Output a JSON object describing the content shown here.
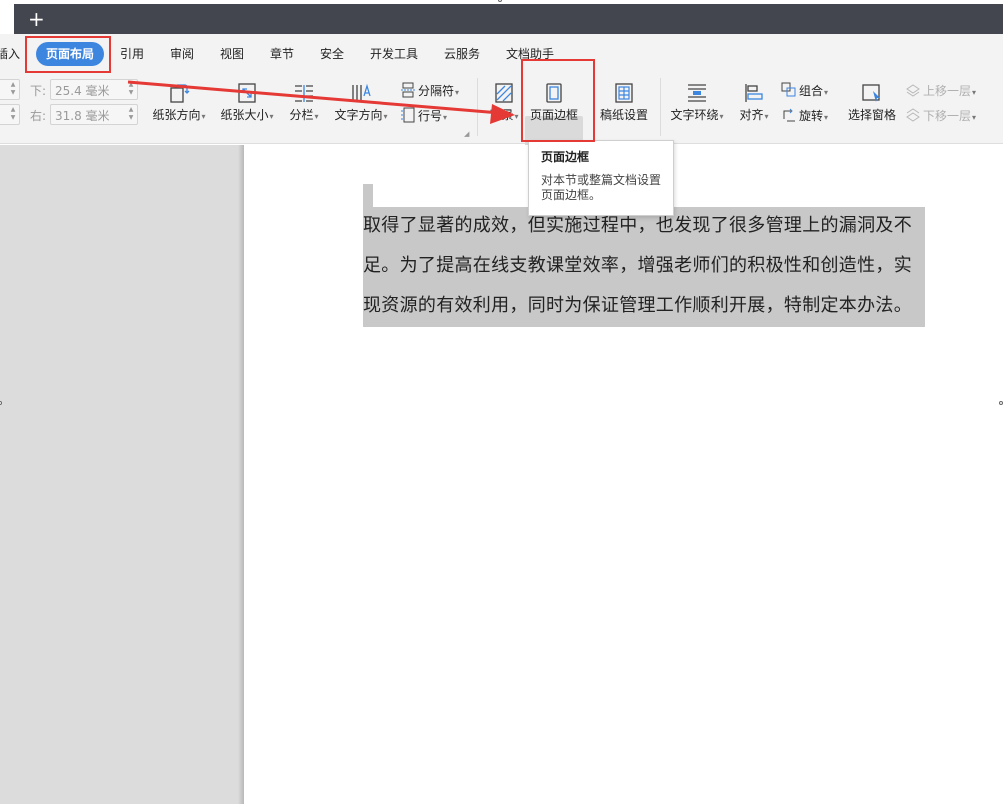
{
  "app": {
    "new_tab_symbol": "+"
  },
  "menu_tabs": [
    {
      "label": "插入"
    },
    {
      "label": "页面布局",
      "active": true
    },
    {
      "label": "引用"
    },
    {
      "label": "审阅"
    },
    {
      "label": "视图"
    },
    {
      "label": "章节"
    },
    {
      "label": "安全"
    },
    {
      "label": "开发工具"
    },
    {
      "label": "云服务"
    },
    {
      "label": "文档助手"
    }
  ],
  "margins": {
    "bottom_label": "下:",
    "bottom_value": "25.4 毫米",
    "right_label": "右:",
    "right_value": "31.8 毫米"
  },
  "toolbar": {
    "paper_orientation": "纸张方向",
    "paper_size": "纸张大小",
    "columns": "分栏",
    "text_direction": "文字方向",
    "separator": "分隔符",
    "line_number": "行号",
    "background": "背景",
    "page_border": "页面边框",
    "manuscript_settings": "稿纸设置",
    "text_wrap": "文字环绕",
    "align": "对齐",
    "group": "组合",
    "rotate": "旋转",
    "selection_pane": "选择窗格",
    "bring_forward": "上移一层",
    "send_backward": "下移一层"
  },
  "tooltip": {
    "title": "页面边框",
    "description": "对本节或整篇文档设置页面边框。"
  },
  "document": {
    "lines": [
      "取得了显著的成效，但实施过程中，也发现了很多管理上的漏洞及不",
      "足。为了提高在线支教课堂效率，增强老师们的积极性和创造性，实",
      "现资源的有效利用，同时为保证管理工作顺利开展，特制定本办法。"
    ]
  },
  "colors": {
    "accent": "#3d86e0",
    "annotation_red": "#e53935",
    "titlebar": "#43454f"
  }
}
